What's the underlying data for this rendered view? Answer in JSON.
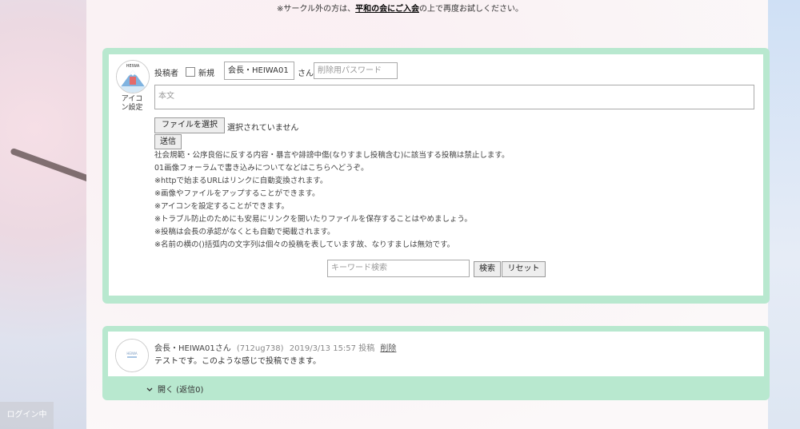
{
  "notice": {
    "prefix": "※サークル外の方は、",
    "link": "平和の会にご入会",
    "suffix": "の上で再度お試しください。"
  },
  "form": {
    "avatar_caption": "アイコン設定",
    "poster_label": "投稿者",
    "new_label": "新規",
    "name_value": "会長・HEIWA01",
    "san_label": "さん",
    "password_placeholder": "削除用パスワード",
    "body_placeholder": "本文",
    "file_button": "ファイルを選択",
    "file_status": "選択されていません",
    "submit_button": "送信",
    "notes": [
      "社会規範・公序良俗に反する内容・暴言や誹謗中傷(なりすまし投稿含む)に該当する投稿は禁止します。",
      "01画像フォーラムで書き込みについてなどはこちらへどうぞ。",
      "※httpで始まるURLはリンクに自動変換されます。",
      "※画像やファイルをアップすることができます。",
      "※アイコンを設定することができます。",
      "※トラブル防止のためにも安易にリンクを開いたりファイルを保存することはやめましょう。",
      "※投稿は会長の承認がなくとも自動で掲載されます。",
      "※名前の横の()括弧内の文字列は個々の投稿を表しています故、なりすましは無効です。"
    ],
    "search_placeholder": "キーワード検索",
    "search_button": "検索",
    "reset_button": "リセット"
  },
  "post": {
    "author": "会長・HEIWA01さん",
    "id": "(712ug738)",
    "datetime": "2019/3/13 15:57 投稿",
    "delete_link": "削除",
    "body": "テストです。このような感じで投稿できます。",
    "expand": "開く (返信0)"
  },
  "login_badge": "ログイン中",
  "colors": {
    "panel_border": "#b8e8cf"
  },
  "icons": {
    "expand": "chevron-down-icon",
    "avatar": "mountain-icon"
  }
}
